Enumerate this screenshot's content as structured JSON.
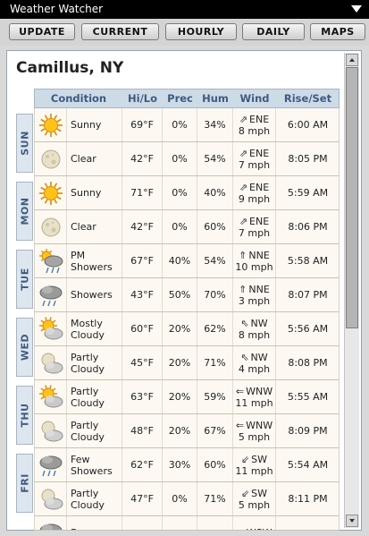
{
  "app": {
    "title": "Weather Watcher"
  },
  "toolbar": {
    "update": "UPDATE",
    "current": "CURRENT",
    "hourly": "HOURLY",
    "daily": "DAILY",
    "maps": "MAPS"
  },
  "location": "Camillus, NY",
  "columns": {
    "condition": "Condition",
    "hilo": "Hi/Lo",
    "prec": "Prec",
    "hum": "Hum",
    "wind": "Wind",
    "riseset": "Rise/Set"
  },
  "days": [
    {
      "label": "SUN"
    },
    {
      "label": "MON"
    },
    {
      "label": "TUE"
    },
    {
      "label": "WED"
    },
    {
      "label": "THU"
    },
    {
      "label": "FRI"
    }
  ],
  "rows": [
    {
      "icon": "sun-icon",
      "condition": "Sunny",
      "temp": "69°F",
      "prec": "0%",
      "hum": "34%",
      "wind_dir": "ENE",
      "wind_speed": "8 mph",
      "time": "6:00 AM",
      "arrow": "⇗"
    },
    {
      "icon": "moon-icon",
      "condition": "Clear",
      "temp": "42°F",
      "prec": "0%",
      "hum": "54%",
      "wind_dir": "ENE",
      "wind_speed": "7 mph",
      "time": "8:05 PM",
      "arrow": "⇗"
    },
    {
      "icon": "sun-icon",
      "condition": "Sunny",
      "temp": "71°F",
      "prec": "0%",
      "hum": "40%",
      "wind_dir": "ENE",
      "wind_speed": "9 mph",
      "time": "5:59 AM",
      "arrow": "⇗"
    },
    {
      "icon": "moon-icon",
      "condition": "Clear",
      "temp": "42°F",
      "prec": "0%",
      "hum": "60%",
      "wind_dir": "ENE",
      "wind_speed": "7 mph",
      "time": "8:06 PM",
      "arrow": "⇗"
    },
    {
      "icon": "sun-rain-icon",
      "condition": "PM Showers",
      "temp": "67°F",
      "prec": "40%",
      "hum": "54%",
      "wind_dir": "NNE",
      "wind_speed": "10 mph",
      "time": "5:58 AM",
      "arrow": "⇑"
    },
    {
      "icon": "rain-cloud-icon",
      "condition": "Showers",
      "temp": "43°F",
      "prec": "50%",
      "hum": "70%",
      "wind_dir": "NNE",
      "wind_speed": "3 mph",
      "time": "8:07 PM",
      "arrow": "⇑"
    },
    {
      "icon": "sun-cloud-icon",
      "condition": "Mostly Cloudy",
      "temp": "60°F",
      "prec": "20%",
      "hum": "62%",
      "wind_dir": "NW",
      "wind_speed": "8 mph",
      "time": "5:56 AM",
      "arrow": "⇖"
    },
    {
      "icon": "moon-cloud-icon",
      "condition": "Partly Cloudy",
      "temp": "45°F",
      "prec": "20%",
      "hum": "71%",
      "wind_dir": "NW",
      "wind_speed": "4 mph",
      "time": "8:08 PM",
      "arrow": "⇖"
    },
    {
      "icon": "sun-cloud-icon",
      "condition": "Partly Cloudy",
      "temp": "63°F",
      "prec": "20%",
      "hum": "59%",
      "wind_dir": "WNW",
      "wind_speed": "11 mph",
      "time": "5:55 AM",
      "arrow": "⇐"
    },
    {
      "icon": "moon-cloud-icon",
      "condition": "Partly Cloudy",
      "temp": "48°F",
      "prec": "20%",
      "hum": "67%",
      "wind_dir": "WNW",
      "wind_speed": "5 mph",
      "time": "8:09 PM",
      "arrow": "⇐"
    },
    {
      "icon": "rain-cloud-icon",
      "condition": "Few Showers",
      "temp": "62°F",
      "prec": "30%",
      "hum": "60%",
      "wind_dir": "SW",
      "wind_speed": "11 mph",
      "time": "5:54 AM",
      "arrow": "⇙"
    },
    {
      "icon": "moon-cloud-icon",
      "condition": "Partly Cloudy",
      "temp": "47°F",
      "prec": "0%",
      "hum": "71%",
      "wind_dir": "SW",
      "wind_speed": "5 mph",
      "time": "8:11 PM",
      "arrow": "⇙"
    },
    {
      "icon": "rain-cloud-icon",
      "condition": "Few",
      "temp": "",
      "prec": "",
      "hum": "",
      "wind_dir": "WSW",
      "wind_speed": "",
      "time": "",
      "arrow": "⇙"
    }
  ]
}
